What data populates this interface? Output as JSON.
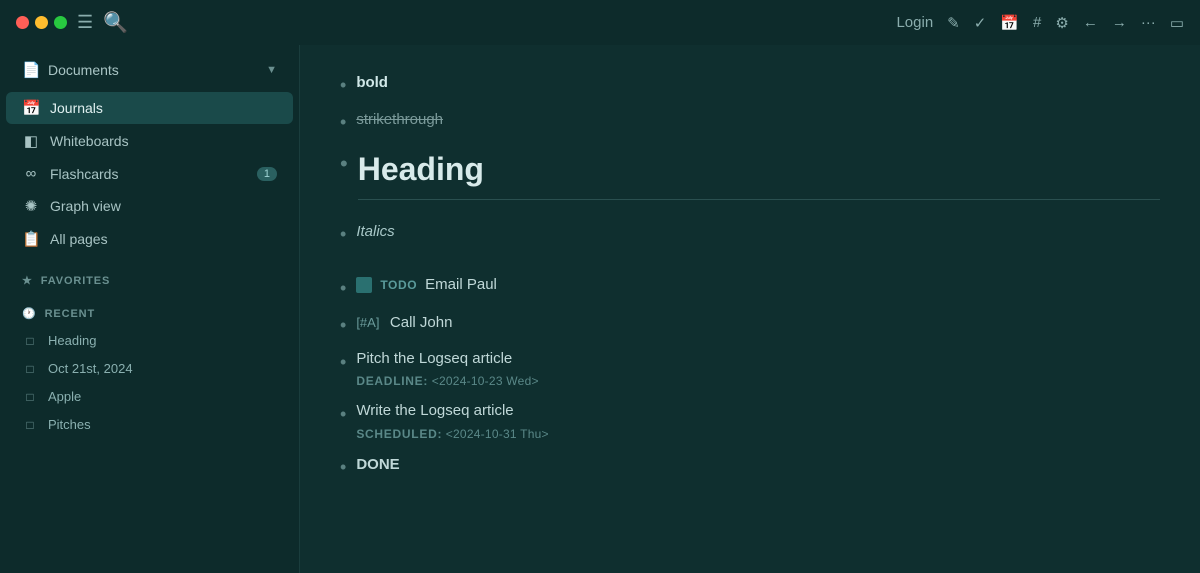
{
  "titlebar": {
    "login_label": "Login",
    "icons": {
      "menu": "☰",
      "search": "⌕",
      "edit": "✎",
      "check": "✓",
      "calendar": "▦",
      "hash": "#",
      "puzzle": "⚙",
      "back": "←",
      "forward": "→",
      "more": "···",
      "sidebar": "▣"
    }
  },
  "sidebar": {
    "documents_label": "Documents",
    "nav_items": [
      {
        "id": "journals",
        "label": "Journals",
        "icon": "calendar",
        "active": true,
        "badge": null
      },
      {
        "id": "whiteboards",
        "label": "Whiteboards",
        "icon": "whiteboard",
        "active": false,
        "badge": null
      },
      {
        "id": "flashcards",
        "label": "Flashcards",
        "icon": "infinity",
        "active": false,
        "badge": "1"
      },
      {
        "id": "graph-view",
        "label": "Graph view",
        "icon": "graph",
        "active": false,
        "badge": null
      },
      {
        "id": "all-pages",
        "label": "All pages",
        "icon": "pages",
        "active": false,
        "badge": null
      }
    ],
    "favorites_label": "FAVORITES",
    "recent_label": "RECENT",
    "recent_items": [
      {
        "id": "heading",
        "label": "Heading"
      },
      {
        "id": "oct21",
        "label": "Oct 21st, 2024"
      },
      {
        "id": "apple",
        "label": "Apple"
      },
      {
        "id": "pitches",
        "label": "Pitches"
      }
    ]
  },
  "content": {
    "bold_text": "bold",
    "strikethrough_text": "strikethrough",
    "heading_text": "Heading",
    "italics_text": "Italics",
    "todo_label": "TODO",
    "todo_task": "Email Paul",
    "priority_prefix": "[#A]",
    "priority_task": "Call John",
    "task1_text": "Pitch the Logseq article",
    "task1_meta_label": "DEADLINE:",
    "task1_meta_date": "<2024-10-23 Wed>",
    "task2_text": "Write the Logseq article",
    "task2_meta_label": "SCHEDULED:",
    "task2_meta_date": "<2024-10-31 Thu>",
    "done_text": "DONE"
  }
}
